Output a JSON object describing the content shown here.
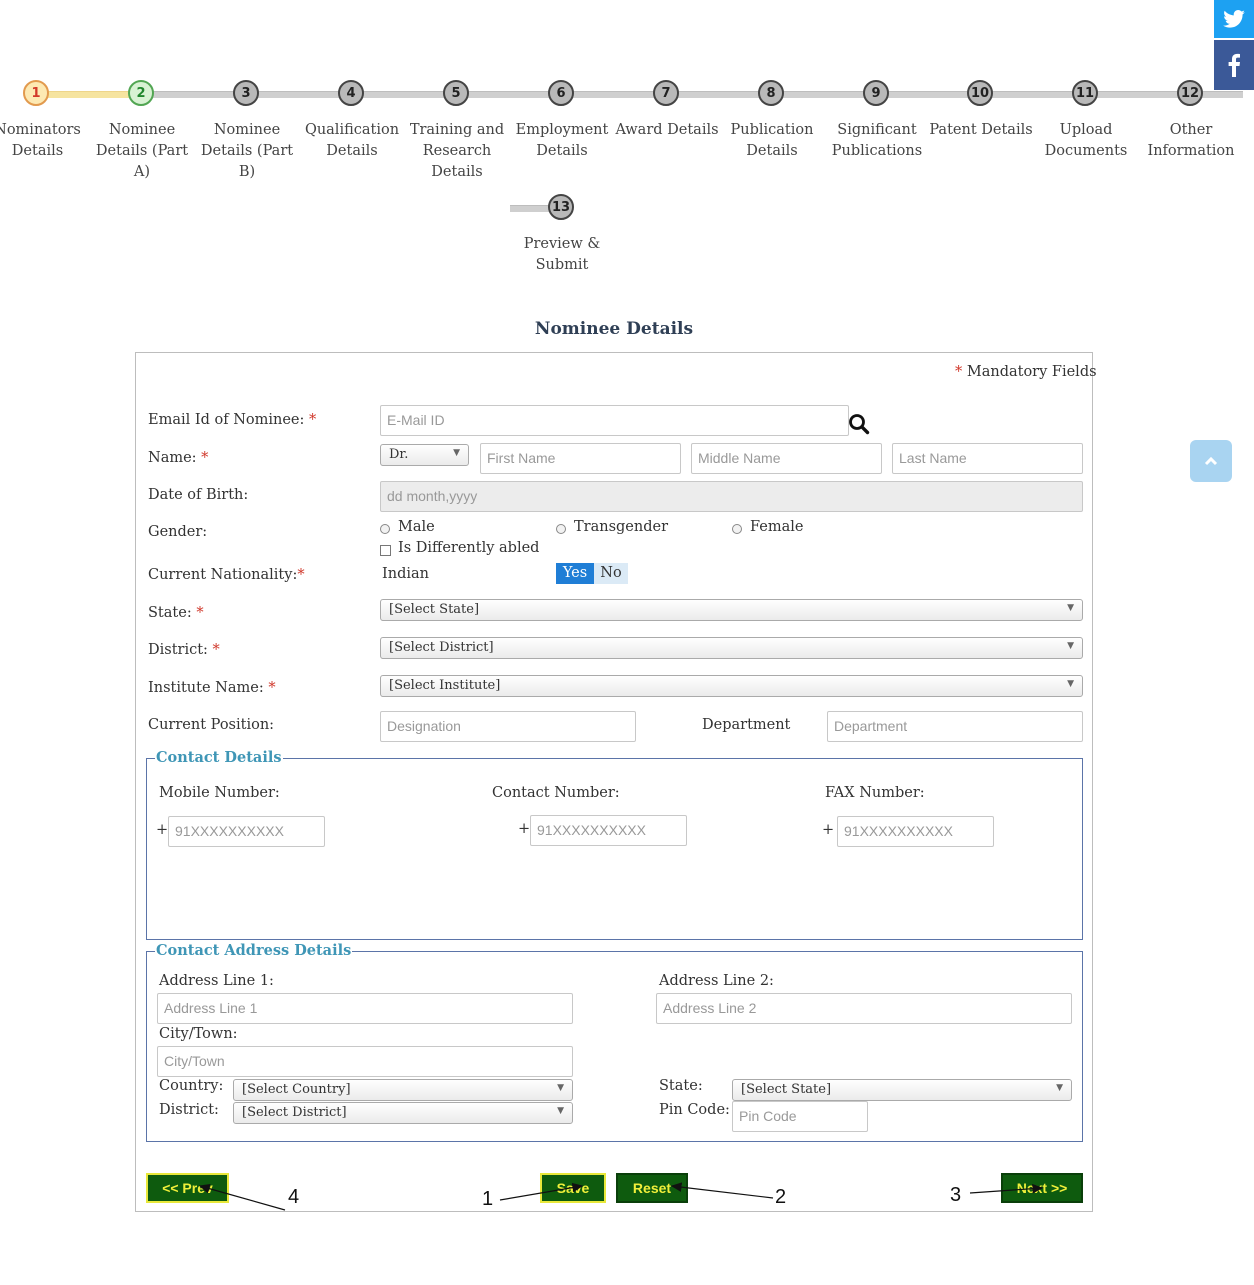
{
  "social": {
    "twitter_icon": "twitter-icon",
    "facebook_icon": "facebook-icon"
  },
  "steps": [
    {
      "num": "1",
      "label": "Nominators Details"
    },
    {
      "num": "2",
      "label": "Nominee Details (Part A)"
    },
    {
      "num": "3",
      "label": "Nominee Details (Part B)"
    },
    {
      "num": "4",
      "label": "Qualification Details"
    },
    {
      "num": "5",
      "label": "Training and Research Details"
    },
    {
      "num": "6",
      "label": "Employment Details"
    },
    {
      "num": "7",
      "label": "Award Details"
    },
    {
      "num": "8",
      "label": "Publication Details"
    },
    {
      "num": "9",
      "label": "Significant Publications"
    },
    {
      "num": "10",
      "label": "Patent Details"
    },
    {
      "num": "11",
      "label": "Upload Documents"
    },
    {
      "num": "12",
      "label": "Other Information"
    },
    {
      "num": "13",
      "label": "Preview & Submit"
    }
  ],
  "form": {
    "title": "Nominee Details",
    "mandatory_star": "*",
    "mandatory_text": "Mandatory Fields",
    "email_label": "Email Id of Nominee:",
    "email_placeholder": "E-Mail ID",
    "name_label": "Name:",
    "title_select": "Dr.",
    "first_name_placeholder": "First Name",
    "middle_name_placeholder": "Middle Name",
    "last_name_placeholder": "Last Name",
    "dob_label": "Date of Birth:",
    "dob_placeholder": "dd month,yyyy",
    "gender_label": "Gender:",
    "gender_male": "Male",
    "gender_transgender": "Transgender",
    "gender_female": "Female",
    "differently_abled": "Is Differently abled",
    "nationality_label": "Current Nationality:",
    "nationality_value": "Indian",
    "yes": "Yes",
    "no": "No",
    "state_label": "State:",
    "state_select": "[Select State]",
    "district_label": "District:",
    "district_select": "[Select District]",
    "institute_label": "Institute Name:",
    "institute_select": "[Select Institute]",
    "position_label": "Current Position:",
    "designation_placeholder": "Designation",
    "department_label": "Department",
    "department_placeholder": "Department"
  },
  "contact": {
    "legend": "Contact Details",
    "mobile_label": "Mobile Number:",
    "contact_label": "Contact Number:",
    "fax_label": "FAX Number:",
    "plus": "+",
    "mobile_placeholder": "91XXXXXXXXXX",
    "contact_placeholder": "91XXXXXXXXXX",
    "fax_placeholder": "91XXXXXXXXXX"
  },
  "address": {
    "legend": "Contact Address Details",
    "line1_label": "Address Line 1:",
    "line1_placeholder": "Address Line 1",
    "line2_label": "Address Line 2:",
    "line2_placeholder": "Address Line 2",
    "city_label": "City/Town:",
    "city_placeholder": "City/Town",
    "country_label": "Country:",
    "country_select": "[Select Country]",
    "state_label": "State:",
    "state_select": "[Select State]",
    "district_label": "District:",
    "district_select": "[Select District]",
    "pin_label": "Pin Code:",
    "pin_placeholder": "Pin Code"
  },
  "buttons": {
    "prev": "<< Prev",
    "save": "Save",
    "reset": "Reset",
    "next": "Next >>"
  },
  "callouts": [
    "1",
    "2",
    "3",
    "4"
  ],
  "colors": {
    "button_bg": "#0e5b0e",
    "button_text": "#f0ef3a",
    "legend": "#3f96b6",
    "required": "#d0382b"
  }
}
